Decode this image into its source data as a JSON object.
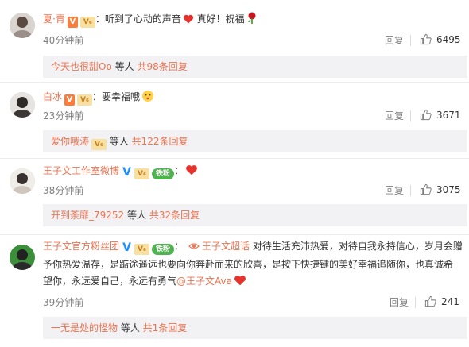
{
  "comments": [
    {
      "name": "夏·青",
      "badge_v": "V",
      "badge_vip": "V₆",
      "colon": "：",
      "text_a": "听到了心动的声音",
      "text_b": " 真好！祝福",
      "time": "40分钟前",
      "reply_label": "回复",
      "likes": "6495",
      "sub_user": "今天也很甜Oo",
      "sub_mid": " 等人 ",
      "sub_count": "共98条回复"
    },
    {
      "name": "白冰",
      "badge_v": "V",
      "badge_vip": "V₆",
      "colon": "：",
      "text_a": "要幸福哦",
      "time": "23分钟前",
      "reply_label": "回复",
      "likes": "3671",
      "sub_user": "爱你哦涛",
      "sub_mid": " 等人 ",
      "sub_count": "共122条回复"
    },
    {
      "name": "王子文工作室微博",
      "badge_v": "V",
      "badge_vip": "V₆",
      "badge_fan": "铁粉",
      "colon": "：",
      "time": "38分钟前",
      "reply_label": "回复",
      "likes": "3075",
      "sub_user": "开到荼靡_79252",
      "sub_mid": " 等人 ",
      "sub_count": "共32条回复"
    },
    {
      "name": "王子文官方粉丝团",
      "badge_v": "V",
      "badge_vip": "V₆",
      "badge_fan": "铁粉",
      "colon": "：",
      "topic": "王子文超话",
      "text_line1": " 对待生活充沛热爱，对待自我永持信心，岁月会赠",
      "text_line2": "予你热爱温存，是踮途遥远也要向你奔赴而来的欣喜，是按下快捷键的美好幸福追随你，也真诚希",
      "text_line3": "望你，永远爱自己，永远有勇气",
      "mention": "@王子文Ava",
      "time": "39分钟前",
      "reply_label": "回复",
      "likes": "241",
      "sub_user": "一无是处的怪物",
      "sub_mid": " 等人 ",
      "sub_count": "共1条回复"
    }
  ],
  "icons": {
    "like": "thumbs-up-icon",
    "heart": "heart-icon",
    "rose": "rose-icon",
    "kiss": "kiss-face-icon",
    "link": "super-topic-icon"
  },
  "colors": {
    "name": "#eb7350",
    "time": "#808080",
    "subbox": "#f2f2f5",
    "heart": "#e8322d"
  }
}
